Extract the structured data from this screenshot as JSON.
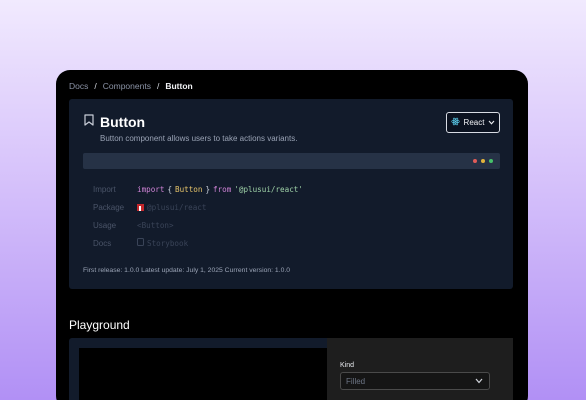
{
  "breadcrumb": {
    "items": [
      "Docs",
      "Components"
    ],
    "current": "Button",
    "separator": "/"
  },
  "header": {
    "title": "Button",
    "subtitle": "Button component allows users to take actions variants.",
    "framework_select": "React"
  },
  "code_bar": {
    "dot_colors": [
      "#e05b58",
      "#e2b33b",
      "#46c06a"
    ]
  },
  "meta": {
    "import_label": "Import",
    "import_code": {
      "kw1": "import",
      "open": "{",
      "name": "Button",
      "close": "}",
      "kw2": "from",
      "path": "'@plusui/react'"
    },
    "package_label": "Package",
    "package_value": "@plusui/react",
    "usage_label": "Usage",
    "usage_value": "<Button>",
    "docs_label": "Docs",
    "docs_value": "Storybook"
  },
  "footer_info": "First release: 1.0.0 Latest update: July 1, 2025 Current version: 1.0.0",
  "playground": {
    "title": "Playground",
    "kind_label": "Kind",
    "kind_value": "Filled"
  },
  "colors": {
    "accent_react": "#5ed3f3",
    "card_bg": "#121b2b"
  }
}
